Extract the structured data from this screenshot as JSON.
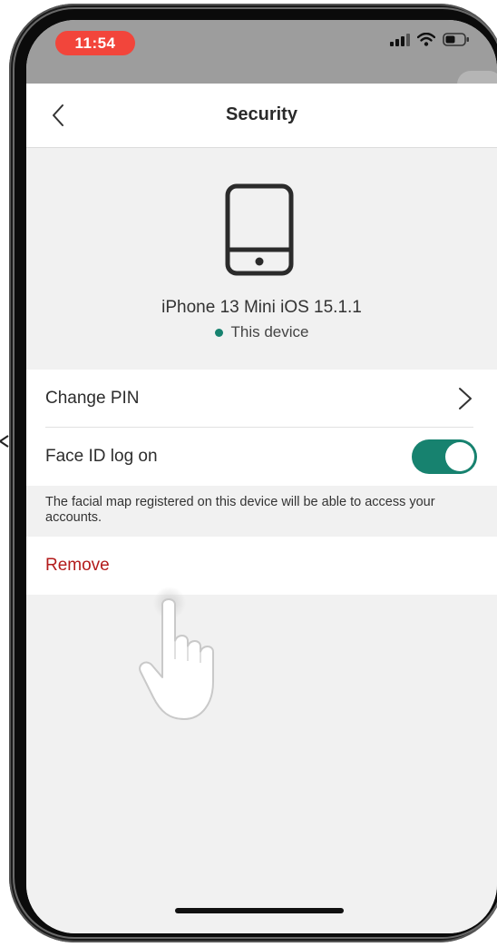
{
  "status_bar": {
    "time": "11:54",
    "icons": [
      "cellular-signal-icon",
      "wifi-icon",
      "battery-icon"
    ]
  },
  "nav": {
    "title": "Security",
    "back_icon": "chevron-left-icon"
  },
  "device": {
    "icon": "smartphone-icon",
    "name": "iPhone 13 Mini iOS 15.1.1",
    "status": "This device",
    "status_color": "#17826f"
  },
  "settings": {
    "change_pin_label": "Change PIN",
    "face_id_label": "Face ID log on",
    "face_id_enabled": true,
    "helper_text": "The facial map registered on this device will be able to access your accounts.",
    "remove_label": "Remove"
  },
  "colors": {
    "accent": "#17826f",
    "destructive": "#b31b1b",
    "time_pill": "#f2453b",
    "background": "#f1f1f1"
  }
}
